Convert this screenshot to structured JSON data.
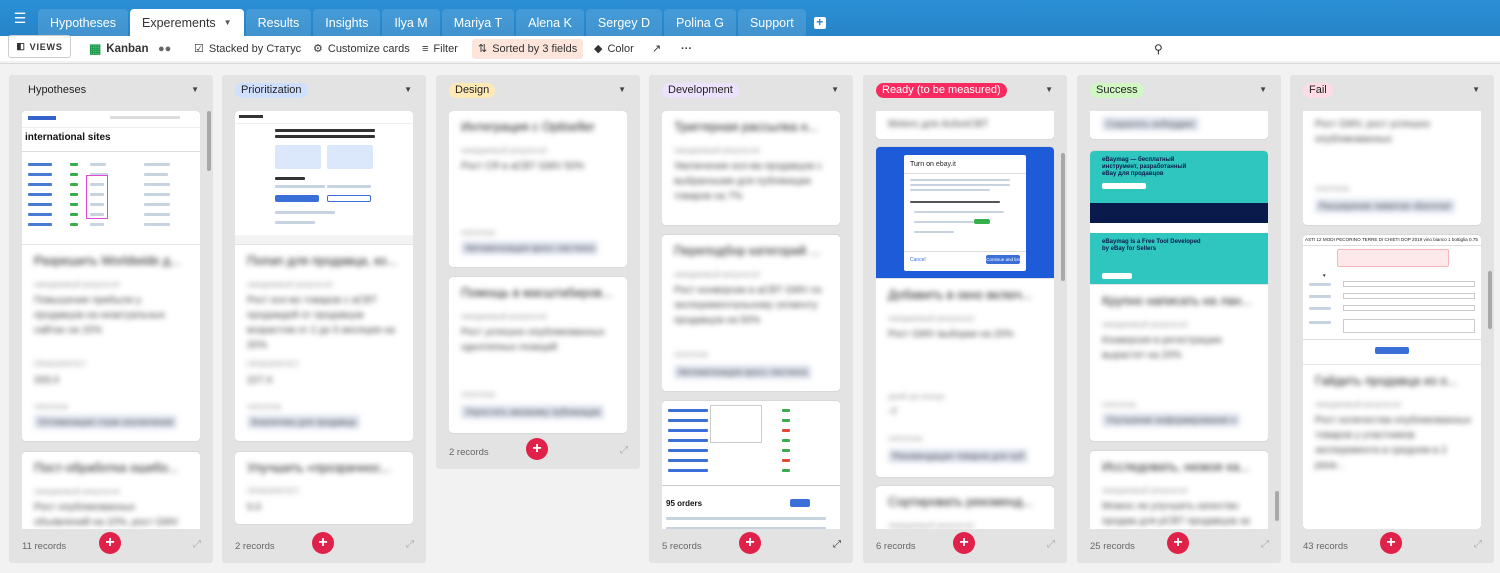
{
  "tabs": [
    "Hypotheses",
    "Experements",
    "Results",
    "Insights",
    "Ilya M",
    "Mariya T",
    "Alena K",
    "Sergey D",
    "Polina G",
    "Support"
  ],
  "active_tab": "Experements",
  "icons": {
    "menu": "menu-icon",
    "add_tab": "plus-square-icon",
    "views": "sidebar-icon",
    "kanban": "kanban-icon",
    "share": "people-icon",
    "stacked": "checkbox-icon",
    "customize": "gear-icon",
    "filter": "filter-icon",
    "sort": "sort-icon",
    "color": "paint-bucket-icon",
    "share_view": "share-icon",
    "more": "more-icon",
    "search": "search-icon",
    "add": "plus-icon",
    "expand": "expand-icon"
  },
  "toolbar": {
    "views": "VIEWS",
    "view_name": "Kanban",
    "stacked": "Stacked by Статус",
    "customize": "Customize cards",
    "filter": "Filter",
    "sorted": "Sorted by 3 fields",
    "color": "Color",
    "more": "···"
  },
  "columns": [
    {
      "title": "Hypotheses",
      "color": "#e4e4e4",
      "count": "11 records"
    },
    {
      "title": "Prioritization",
      "color": "#cfdfff",
      "count": "2 records"
    },
    {
      "title": "Design",
      "color": "#ffeab6",
      "count": "2 records"
    },
    {
      "title": "Development",
      "color": "#ede2fe",
      "count": "5 records"
    },
    {
      "title": "Ready (to be measured)",
      "color": "#f82b60",
      "count": "6 records"
    },
    {
      "title": "Success",
      "color": "#d1f7c4",
      "count": "25 records"
    },
    {
      "title": "Fail",
      "color": "#ffdce5",
      "count": "43 records"
    }
  ],
  "cards": {
    "c1a": {
      "title": "Разрешить Worldwide д...",
      "l1": "ожидаемый результат",
      "v1": "Повышение прибыли у продавцов на неактуальных сайтах на 15%",
      "l2": "ПРИОРИТЕТ",
      "v2": "333.0",
      "l3": "гипотеза",
      "tag": "Оптимизация стран исключения"
    },
    "c1b": {
      "title": "Пост-обработка ошибо...",
      "l1": "ожидаемый результат",
      "v1": "Рост опубликованных объявлений на 10%, рост GMV"
    },
    "c2a": {
      "title": "Попап для продавца, ко...",
      "l1": "ожидаемый результат",
      "v1": "Рост кол-во товаров с aCBT продаждей от продавцов возрастом от 2 до 6 месяцев на 20%",
      "l2": "ПРИОРИТЕТ",
      "v2": "227.4",
      "l3": "гипотеза",
      "tag": "Аналитика для продавца"
    },
    "c2b": {
      "title": "Улучшить «прозрачнос...",
      "l1": "ПРИОРИТЕТ",
      "v1": "0.0"
    },
    "c3a": {
      "title": "Интеграция с Optiseller",
      "l1": "ожидаемый результат",
      "v1": "Рост CR в aCBT GMV 50%",
      "l3": "гипотеза",
      "tag": "Автоматизация кросс-листинга"
    },
    "c3b": {
      "title": "Помощь в масштабиров...",
      "l1": "ожидаемый результат",
      "v1": "Рост успешно опубликованных однотипных позиций",
      "l3": "гипотеза",
      "tag": "Упростить механику публикации"
    },
    "c4a": {
      "title": "Триггерная рассылка н...",
      "l1": "ожидаемый результат",
      "v1": "Увеличение кол-ва продавцов с выбранными для публикации товаров на 7%"
    },
    "c4b": {
      "title": "Переподбор категорий ...",
      "l1": "ожидаемый результат",
      "v1": "Рост конверсии в aCBT GMV по экспериментальному сегменту продавцов на 50%",
      "l3": "гипотеза",
      "tag": "Автоматизация кросс-листинга"
    },
    "c5top": {
      "title": "Motors для ActiveCBT"
    },
    "c5a": {
      "title": "Добавить в окно включ...",
      "l1": "ожидаемый результат",
      "v1": "Рост GMV выборки на 20%",
      "l2": "дней до конца",
      "v2": "-7",
      "l3": "гипотеза",
      "tag": "Рекомендация товаров для пуб"
    },
    "c5b": {
      "title": "Сортировать рекоменд...",
      "l1": "ожидаемый результат"
    },
    "c6top": {
      "tag": "Сократить онбординг"
    },
    "c6a": {
      "title": "Крупно написать на лан...",
      "l1": "ожидаемый результат",
      "v1": "Конверсия в регистрацию вырастет на 20%",
      "l3": "гипотеза",
      "tag": "Улучшение информирования о"
    },
    "c6b": {
      "title": "Исследовать, низкое ка...",
      "l1": "ожидаемый результат",
      "v1": "Можно ли улучшить качество продаж для рCBT продавцов за"
    },
    "c7top": {
      "v1": "Рост GMV, рост успешно опубликованных",
      "l3": "гипотеза",
      "tag": "Расширение лимитов «Бесплат"
    },
    "c7a": {
      "title": "Гайдить продавца из о...",
      "l1": "ожидаемый результат",
      "v1": "Рост количества опубликованных товаров у участников эксперимента в среднем в 2 раза..."
    }
  },
  "shots": {
    "s1_title": "international sites",
    "s4_orders": "95 orders",
    "s5_title": "Turn on",
    "s5_brand": "ebay.it",
    "s5_btn_cancel": "Cancel",
    "s5_btn_ok": "Continue and list",
    "s6_text1": "eBaymag — бесплатный инструмент, разработанный eBay для продавцов",
    "s6_text2": "eBaymag is a Free Tool Developed by eBay for Sellers",
    "s7_header": "ASTI 12 MODI PECORINO TERRE DI CHIETI DOP 2019 vino bianco 1 bottiglia 0.75"
  }
}
